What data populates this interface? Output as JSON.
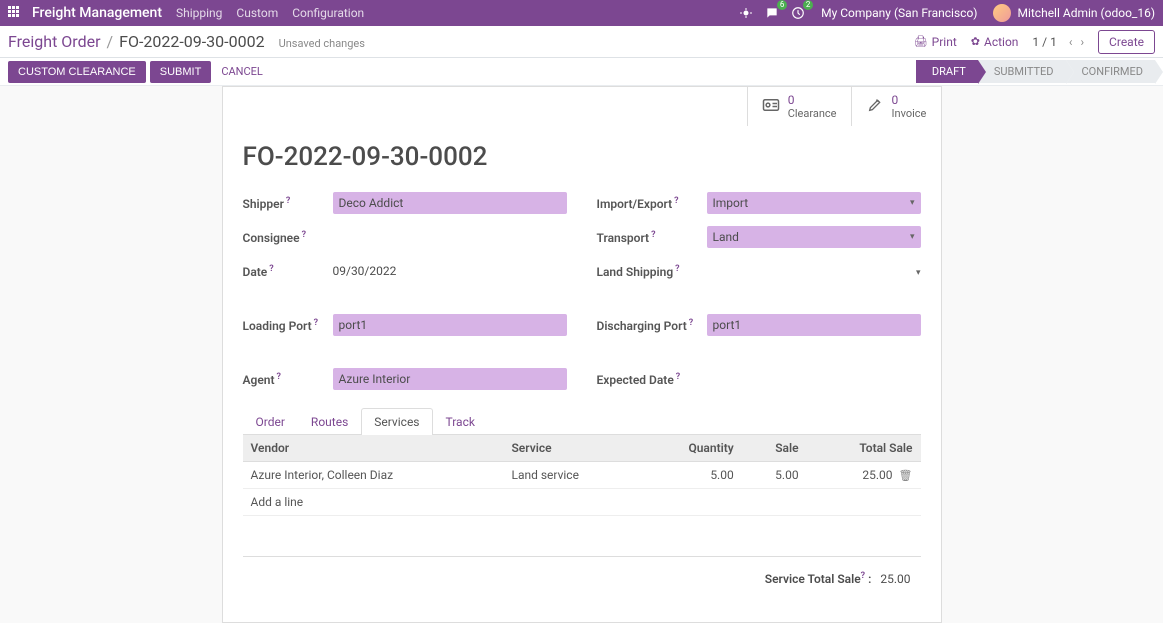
{
  "navbar": {
    "brand": "Freight Management",
    "menu": [
      "Shipping",
      "Custom",
      "Configuration"
    ],
    "chat_badge": "6",
    "timer_badge": "2",
    "company": "My Company (San Francisco)",
    "user": "Mitchell Admin (odoo_16)"
  },
  "ctrlbar": {
    "breadcrumb_back": "Freight Order",
    "breadcrumb_current": "FO-2022-09-30-0002",
    "unsaved": "Unsaved changes",
    "print": "Print",
    "action": "Action",
    "pager": "1 / 1",
    "create": "Create"
  },
  "statusbar": {
    "btn_clearance": "CUSTOM CLEARANCE",
    "btn_submit": "SUBMIT",
    "btn_cancel": "CANCEL",
    "steps": [
      "DRAFT",
      "SUBMITTED",
      "CONFIRMED"
    ]
  },
  "stats": {
    "clearance_count": "0",
    "clearance_label": "Clearance",
    "invoice_count": "0",
    "invoice_label": "Invoice"
  },
  "form": {
    "title": "FO-2022-09-30-0002",
    "labels": {
      "shipper": "Shipper",
      "consignee": "Consignee",
      "date": "Date",
      "loading_port": "Loading Port",
      "agent": "Agent",
      "import_export": "Import/Export",
      "transport": "Transport",
      "land_shipping": "Land Shipping",
      "discharging_port": "Discharging Port",
      "expected_date": "Expected Date"
    },
    "values": {
      "shipper": "Deco Addict",
      "consignee": "",
      "date": "09/30/2022",
      "loading_port": "port1",
      "agent": "Azure Interior",
      "import_export": "Import",
      "transport": "Land",
      "land_shipping": "",
      "discharging_port": "port1",
      "expected_date": ""
    }
  },
  "tabs": [
    "Order",
    "Routes",
    "Services",
    "Track"
  ],
  "table": {
    "headers": {
      "vendor": "Vendor",
      "service": "Service",
      "quantity": "Quantity",
      "sale": "Sale",
      "total_sale": "Total Sale"
    },
    "rows": [
      {
        "vendor": "Azure Interior, Colleen Diaz",
        "service": "Land service",
        "quantity": "5.00",
        "sale": "5.00",
        "total_sale": "25.00"
      }
    ],
    "add_line": "Add a line"
  },
  "totals": {
    "label": "Service Total Sale",
    "value": "25.00"
  }
}
